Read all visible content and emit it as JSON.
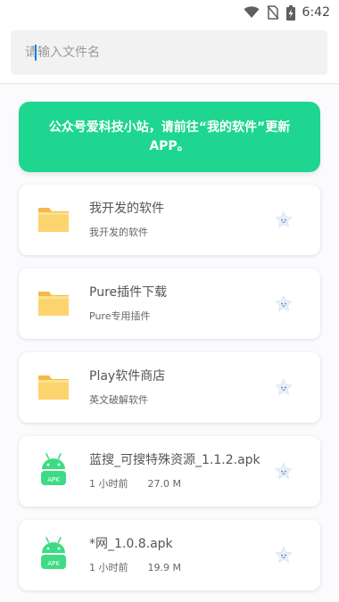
{
  "status_bar": {
    "time": "6:42",
    "icons": [
      "wifi-icon",
      "no-sim-icon",
      "battery-charging-icon"
    ]
  },
  "search": {
    "placeholder": "请输入文件名",
    "value": ""
  },
  "notice": {
    "text": "公众号爱科技小站，请前往“我的软件”更新APP。"
  },
  "colors": {
    "accent_green": "#1ed68f",
    "folder_yellow": "#fbd46b",
    "android_green": "#3ddc84"
  },
  "items": [
    {
      "icon": "folder-icon",
      "title": "我开发的软件",
      "subtitle": "我开发的软件",
      "time": "",
      "size": "",
      "action_icon": "star-face-icon"
    },
    {
      "icon": "folder-icon",
      "title": "Pure插件下载",
      "subtitle": "Pure专用插件",
      "time": "",
      "size": "",
      "action_icon": "star-face-icon"
    },
    {
      "icon": "folder-icon",
      "title": "Play软件商店",
      "subtitle": "英文破解软件",
      "time": "",
      "size": "",
      "action_icon": "star-face-icon"
    },
    {
      "icon": "apk-android-icon",
      "title": "蓝搜_可搜特殊资源_1.1.2.apk",
      "subtitle": "",
      "time": "1 小时前",
      "size": "27.0 M",
      "action_icon": "star-face-icon",
      "badge": "APK"
    },
    {
      "icon": "apk-android-icon",
      "title": "*网_1.0.8.apk",
      "subtitle": "",
      "time": "1 小时前",
      "size": "19.9 M",
      "action_icon": "star-face-icon",
      "badge": "APK"
    }
  ]
}
